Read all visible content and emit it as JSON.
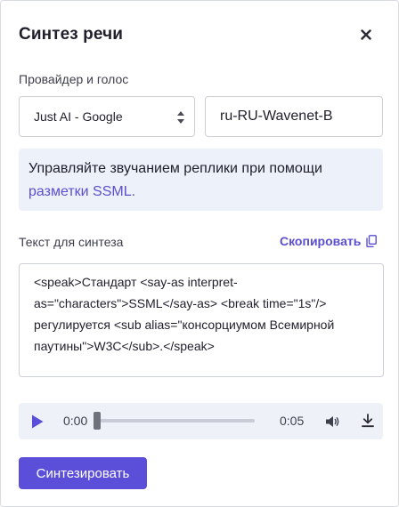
{
  "dialog": {
    "title": "Синтез речи"
  },
  "voice": {
    "section_label": "Провайдер и голос",
    "provider_value": "Just AI - Google",
    "voice_value": "ru-RU-Wavenet-B"
  },
  "info": {
    "text": "Управляйте звучанием реплики при помощи ",
    "link_text": "разметки SSML."
  },
  "text_section": {
    "label": "Текст для синтеза",
    "copy_label": "Скопировать",
    "ssml_value": "<speak>Стандарт <say-as interpret-as=\"characters\">SSML</say-as> <break time=\"1s\"/> регулируется <sub alias=\"консорциумом Всемирной паутины\">W3C</sub>.</speak>"
  },
  "player": {
    "current_time": "0:00",
    "duration": "0:05",
    "progress_fraction": 0
  },
  "actions": {
    "synthesize_label": "Синтезировать"
  },
  "colors": {
    "accent": "#5b4fd9",
    "link": "#5b4fcf",
    "info_background": "#edf1f9",
    "player_background": "#eef1f7"
  },
  "icons": {
    "close": "close-icon",
    "select_arrows": "select-arrows-icon",
    "copy": "copy-icon",
    "play": "play-icon",
    "volume": "volume-icon",
    "download": "download-icon"
  }
}
